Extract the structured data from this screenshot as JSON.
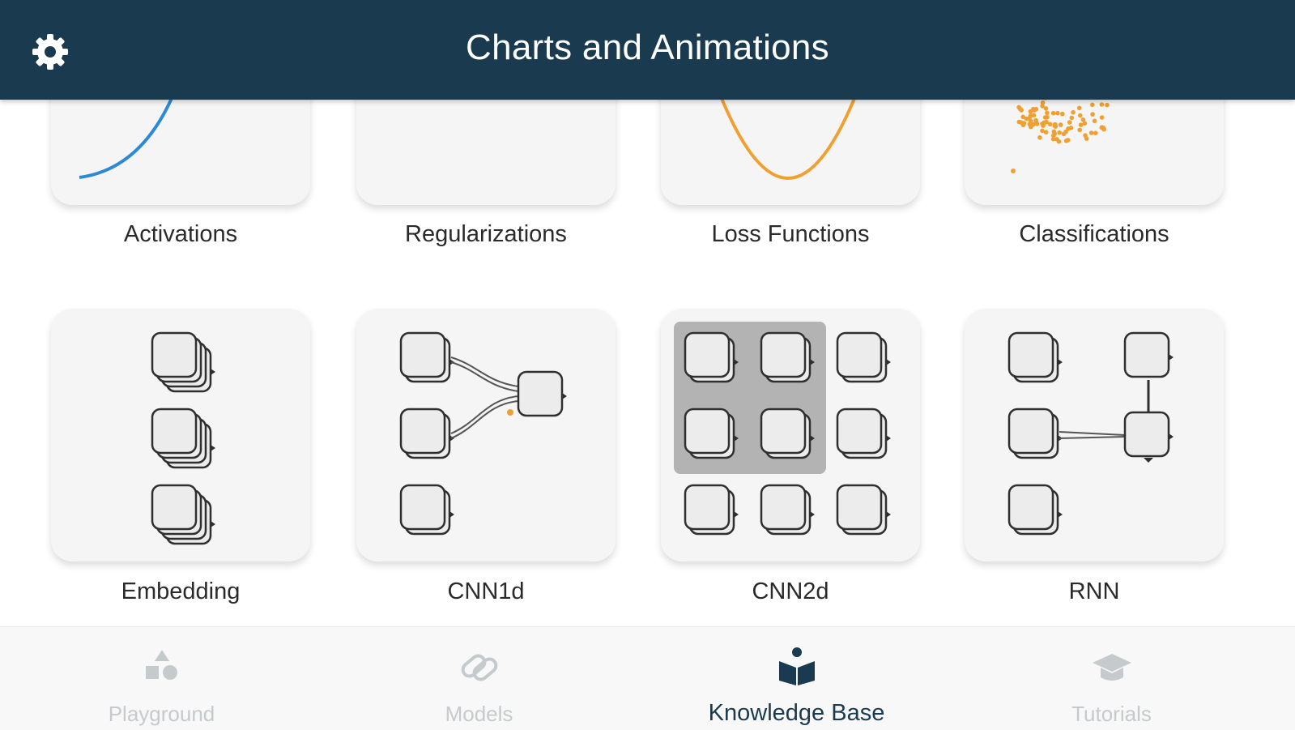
{
  "header": {
    "title": "Charts and Animations",
    "settings_icon": "gear-icon"
  },
  "cards": [
    {
      "label": "Activations",
      "icon": "activation-curve-chart"
    },
    {
      "label": "Regularizations",
      "icon": "regularization-chart"
    },
    {
      "label": "Loss Functions",
      "icon": "loss-parabola-chart"
    },
    {
      "label": "Classifications",
      "icon": "scatter-points-chart"
    },
    {
      "label": "Embedding",
      "icon": "embedding-stacks-diagram"
    },
    {
      "label": "CNN1d",
      "icon": "cnn1d-diagram"
    },
    {
      "label": "CNN2d",
      "icon": "cnn2d-grid-diagram"
    },
    {
      "label": "RNN",
      "icon": "rnn-diagram"
    }
  ],
  "tabbar": {
    "tabs": [
      {
        "label": "Playground",
        "icon": "shapes-icon",
        "active": false
      },
      {
        "label": "Models",
        "icon": "links-icon",
        "active": false
      },
      {
        "label": "Knowledge Base",
        "icon": "book-reader-icon",
        "active": true
      },
      {
        "label": "Tutorials",
        "icon": "graduation-cap-icon",
        "active": false
      }
    ]
  },
  "colors": {
    "header_bg": "#1a3a4f",
    "active_tab": "#1a3a4f",
    "inactive_tab": "#c5cacd",
    "activation_line": "#2b8ad6",
    "loss_line": "#f0a030",
    "scatter_points": "#f0a030"
  }
}
